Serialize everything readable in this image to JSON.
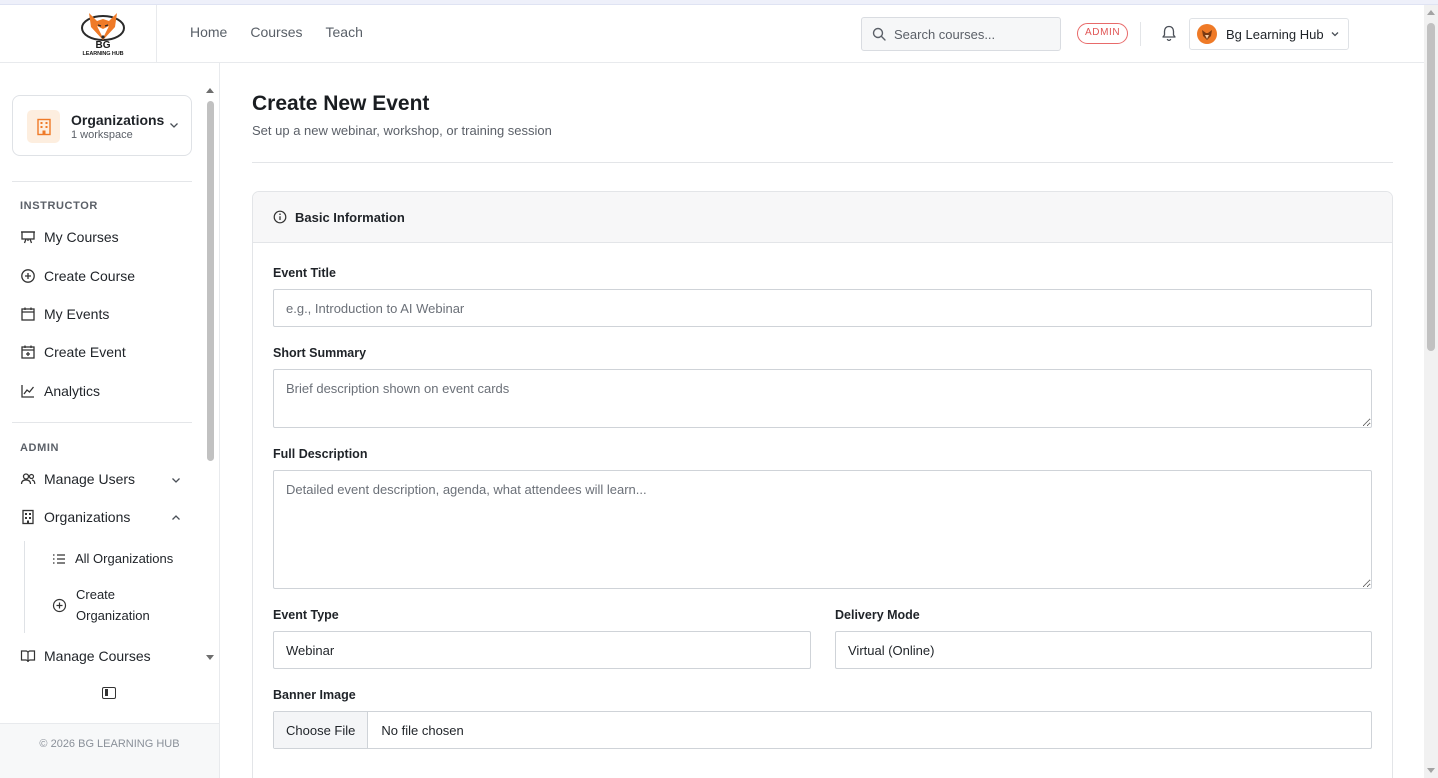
{
  "brand": {
    "logo_line1": "BG",
    "logo_line2": "LEARNING HUB",
    "accent": "#ef7a27"
  },
  "header": {
    "nav": [
      "Home",
      "Courses",
      "Teach"
    ],
    "search_placeholder": "Search courses...",
    "role_badge": "ADMIN",
    "notifications_icon": "bell-icon",
    "user_name": "Bg Learning Hub"
  },
  "sidebar": {
    "org_switcher": {
      "title": "Organizations",
      "subtitle": "1 workspace",
      "icon": "building-icon"
    },
    "instructor_heading": "INSTRUCTOR",
    "instructor_items": [
      {
        "label": "My Courses",
        "icon": "presentation-icon"
      },
      {
        "label": "Create Course",
        "icon": "plus-circle-icon"
      },
      {
        "label": "My Events",
        "icon": "calendar-icon"
      },
      {
        "label": "Create Event",
        "icon": "calendar-plus-icon"
      },
      {
        "label": "Analytics",
        "icon": "chart-line-icon"
      }
    ],
    "admin_heading": "ADMIN",
    "admin_items": [
      {
        "label": "Manage Users",
        "icon": "users-icon",
        "expanded": false
      },
      {
        "label": "Organizations",
        "icon": "building-icon",
        "expanded": true
      },
      {
        "label": "Manage Courses",
        "icon": "book-icon",
        "expanded": false
      }
    ],
    "org_subitems": [
      {
        "label": "All Organizations",
        "icon": "list-icon"
      },
      {
        "label": "Create Organization",
        "icon": "plus-circle-icon"
      }
    ],
    "footer": "© 2026 BG LEARNING HUB"
  },
  "main": {
    "title": "Create New Event",
    "subtitle": "Set up a new webinar, workshop, or training session",
    "section": {
      "title": "Basic Information",
      "icon": "info-icon"
    },
    "fields": {
      "event_title": {
        "label": "Event Title",
        "placeholder": "e.g., Introduction to AI Webinar",
        "value": ""
      },
      "short_summary": {
        "label": "Short Summary",
        "placeholder": "Brief description shown on event cards",
        "value": ""
      },
      "full_description": {
        "label": "Full Description",
        "placeholder": "Detailed event description, agenda, what attendees will learn...",
        "value": ""
      },
      "event_type": {
        "label": "Event Type",
        "value": "Webinar"
      },
      "delivery_mode": {
        "label": "Delivery Mode",
        "value": "Virtual (Online)"
      },
      "banner_image": {
        "label": "Banner Image",
        "button": "Choose File",
        "status": "No file chosen"
      }
    }
  }
}
